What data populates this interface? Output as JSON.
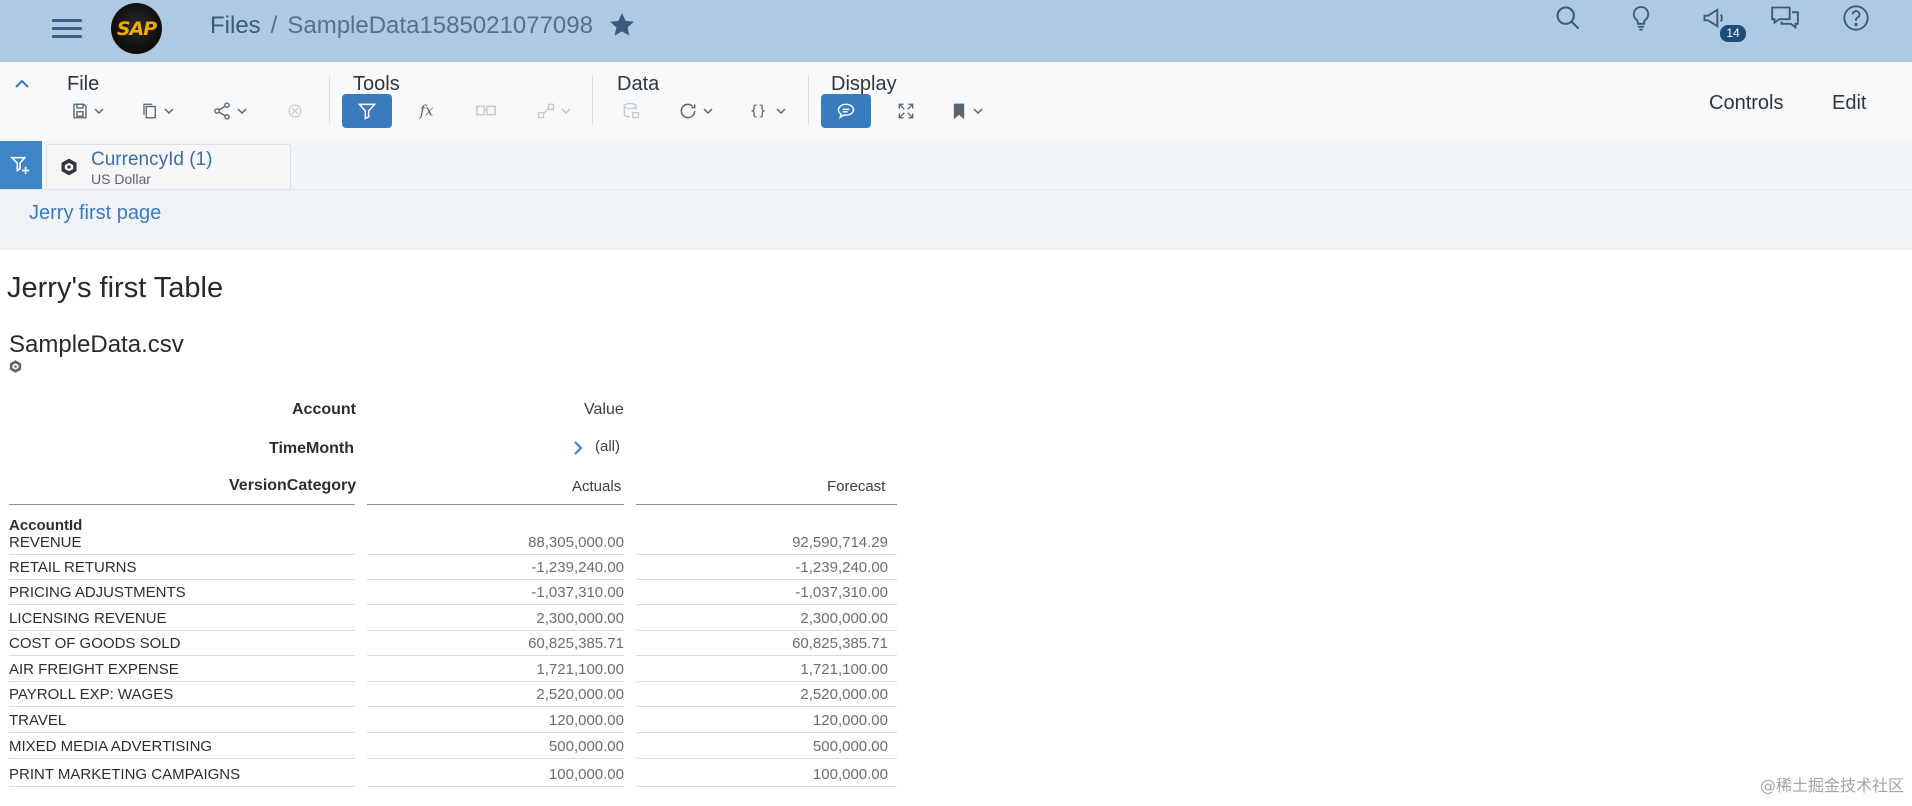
{
  "shellbar": {
    "logo_text": "SAP",
    "breadcrumb_root": "Files",
    "breadcrumb_sep": "/",
    "file_name": "SampleData1585021077098",
    "notification_count": "14",
    "icons": [
      "menu-icon",
      "star-icon",
      "search-icon",
      "lightbulb-icon",
      "megaphone-icon",
      "chat-icon",
      "help-icon"
    ]
  },
  "toolbar": {
    "groups": {
      "file": "File",
      "tools": "Tools",
      "data": "Data",
      "display": "Display"
    },
    "controls_label": "Controls",
    "edit_label": "Edit"
  },
  "filterbar": {
    "token_title": "CurrencyId (1)",
    "token_value": "US Dollar"
  },
  "page": {
    "tab_label": "Jerry first page",
    "title": "Jerry's first Table"
  },
  "table": {
    "tile_title": "SampleData.csv",
    "headers": {
      "account": "Account",
      "value": "Value",
      "timemonth": "TimeMonth",
      "all": "(all)",
      "versioncategory": "VersionCategory",
      "actuals": "Actuals",
      "forecast": "Forecast",
      "accountid": "AccountId"
    },
    "rows": [
      {
        "label": "REVENUE",
        "actuals": "88,305,000.00",
        "forecast": "92,590,714.29"
      },
      {
        "label": "RETAIL RETURNS",
        "actuals": "-1,239,240.00",
        "forecast": "-1,239,240.00"
      },
      {
        "label": "PRICING ADJUSTMENTS",
        "actuals": "-1,037,310.00",
        "forecast": "-1,037,310.00"
      },
      {
        "label": "LICENSING REVENUE",
        "actuals": "2,300,000.00",
        "forecast": "2,300,000.00"
      },
      {
        "label": "COST OF GOODS SOLD",
        "actuals": "60,825,385.71",
        "forecast": "60,825,385.71"
      },
      {
        "label": "AIR FREIGHT EXPENSE",
        "actuals": "1,721,100.00",
        "forecast": "1,721,100.00"
      },
      {
        "label": "PAYROLL EXP: WAGES",
        "actuals": "2,520,000.00",
        "forecast": "2,520,000.00"
      },
      {
        "label": "TRAVEL",
        "actuals": "120,000.00",
        "forecast": "120,000.00"
      },
      {
        "label": "MIXED MEDIA ADVERTISING",
        "actuals": "500,000.00",
        "forecast": "500,000.00"
      },
      {
        "label": "PRINT MARKETING CAMPAIGNS",
        "actuals": "100,000.00",
        "forecast": "100,000.00"
      }
    ]
  },
  "watermark": "@稀土掘金技术社区",
  "colors": {
    "shellbar": "#aecae2",
    "accent": "#3a7bbd",
    "filter_button": "#3e85c6"
  }
}
